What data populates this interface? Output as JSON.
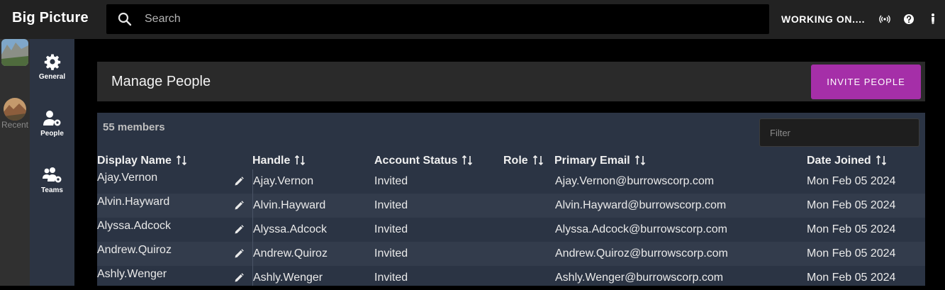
{
  "app": {
    "title": "Big Picture"
  },
  "search": {
    "placeholder": "Search"
  },
  "topbar": {
    "status": "WORKING ON....",
    "icons": [
      "broadcast-icon",
      "help-icon",
      "accessibility-icon"
    ]
  },
  "rail": {
    "recent_label": "Recent"
  },
  "nav": {
    "items": [
      {
        "label": "General",
        "icon": "gear-icon"
      },
      {
        "label": "People",
        "icon": "people-settings-icon"
      },
      {
        "label": "Teams",
        "icon": "teams-settings-icon"
      }
    ]
  },
  "page": {
    "title": "Manage People",
    "invite_label": "INVITE PEOPLE"
  },
  "table": {
    "member_count": "55 members",
    "filter_placeholder": "Filter",
    "columns": [
      "Display Name",
      "Handle",
      "Account Status",
      "Role",
      "Primary Email",
      "Date Joined"
    ],
    "rows": [
      {
        "display_name": "Ajay.Vernon",
        "handle": "Ajay.Vernon",
        "status": "Invited",
        "role": "",
        "email": "Ajay.Vernon@burrowscorp.com",
        "joined": "Mon Feb 05 2024"
      },
      {
        "display_name": "Alvin.Hayward",
        "handle": "Alvin.Hayward",
        "status": "Invited",
        "role": "",
        "email": "Alvin.Hayward@burrowscorp.com",
        "joined": "Mon Feb 05 2024"
      },
      {
        "display_name": "Alyssa.Adcock",
        "handle": "Alyssa.Adcock",
        "status": "Invited",
        "role": "",
        "email": "Alyssa.Adcock@burrowscorp.com",
        "joined": "Mon Feb 05 2024"
      },
      {
        "display_name": "Andrew.Quiroz",
        "handle": "Andrew.Quiroz",
        "status": "Invited",
        "role": "",
        "email": "Andrew.Quiroz@burrowscorp.com",
        "joined": "Mon Feb 05 2024"
      },
      {
        "display_name": "Ashly.Wenger",
        "handle": "Ashly.Wenger",
        "status": "Invited",
        "role": "",
        "email": "Ashly.Wenger@burrowscorp.com",
        "joined": "Mon Feb 05 2024"
      }
    ]
  },
  "colors": {
    "accent": "#a52fa8",
    "nav_bg": "#2c3443",
    "table_bg": "#2b3444"
  }
}
